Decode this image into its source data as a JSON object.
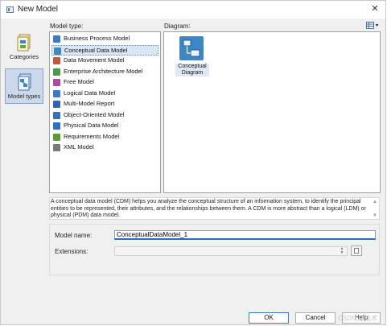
{
  "window": {
    "title": "New Model",
    "close_glyph": "✕"
  },
  "labels": {
    "model_type": "Model type:",
    "diagram": "Diagram:"
  },
  "categories": [
    {
      "label": "Categories",
      "icon": "categories-icon",
      "selected": false
    },
    {
      "label": "Model types",
      "icon": "model-types-icon",
      "selected": true
    }
  ],
  "model_types": [
    {
      "label": "Business Process Model",
      "icon": "bpm-icon",
      "color": "#3b7dc0",
      "selected": false
    },
    {
      "label": "Conceptual Data Model",
      "icon": "cdm-icon",
      "color": "#3e86c4",
      "selected": true
    },
    {
      "label": "Data Movement Model",
      "icon": "dmm-icon",
      "color": "#c05a3b",
      "selected": false
    },
    {
      "label": "Enterprise Architecture Model",
      "icon": "eam-icon",
      "color": "#4a9a4a",
      "selected": false
    },
    {
      "label": "Free Model",
      "icon": "free-model-icon",
      "color": "#b04aa0",
      "selected": false
    },
    {
      "label": "Logical Data Model",
      "icon": "ldm-icon",
      "color": "#3e7ac4",
      "selected": false
    },
    {
      "label": "Multi-Model Report",
      "icon": "mmr-icon",
      "color": "#2f63b8",
      "selected": false
    },
    {
      "label": "Object-Oriented Model",
      "icon": "oom-icon",
      "color": "#3a6fb5",
      "selected": false
    },
    {
      "label": "Physical Data Model",
      "icon": "pdm-icon",
      "color": "#2d6fc0",
      "selected": false
    },
    {
      "label": "Requirements Model",
      "icon": "requirements-icon",
      "color": "#5a9c36",
      "selected": false
    },
    {
      "label": "XML Model",
      "icon": "xml-model-icon",
      "color": "#7a7a7a",
      "selected": false
    }
  ],
  "diagrams": [
    {
      "label": "Conceptual Diagram",
      "line1": "Conceptual",
      "line2": "Diagram",
      "icon": "conceptual-diagram-icon"
    }
  ],
  "description": "A conceptual data model (CDM) helps you analyze the conceptual structure of an information system, to identify the principal entities to be represented, their attributes, and the relationships between them. A CDM is more abstract than a logical (LDM) or physical (PDM) data model.",
  "form": {
    "model_name_label": "Model name:",
    "model_name_value": "ConceptualDataModel_1",
    "extensions_label": "Extensions:",
    "extensions_value": ""
  },
  "buttons": {
    "ok": "OK",
    "cancel": "Cancel",
    "help": "Help"
  },
  "watermark": "CSDN @技术"
}
